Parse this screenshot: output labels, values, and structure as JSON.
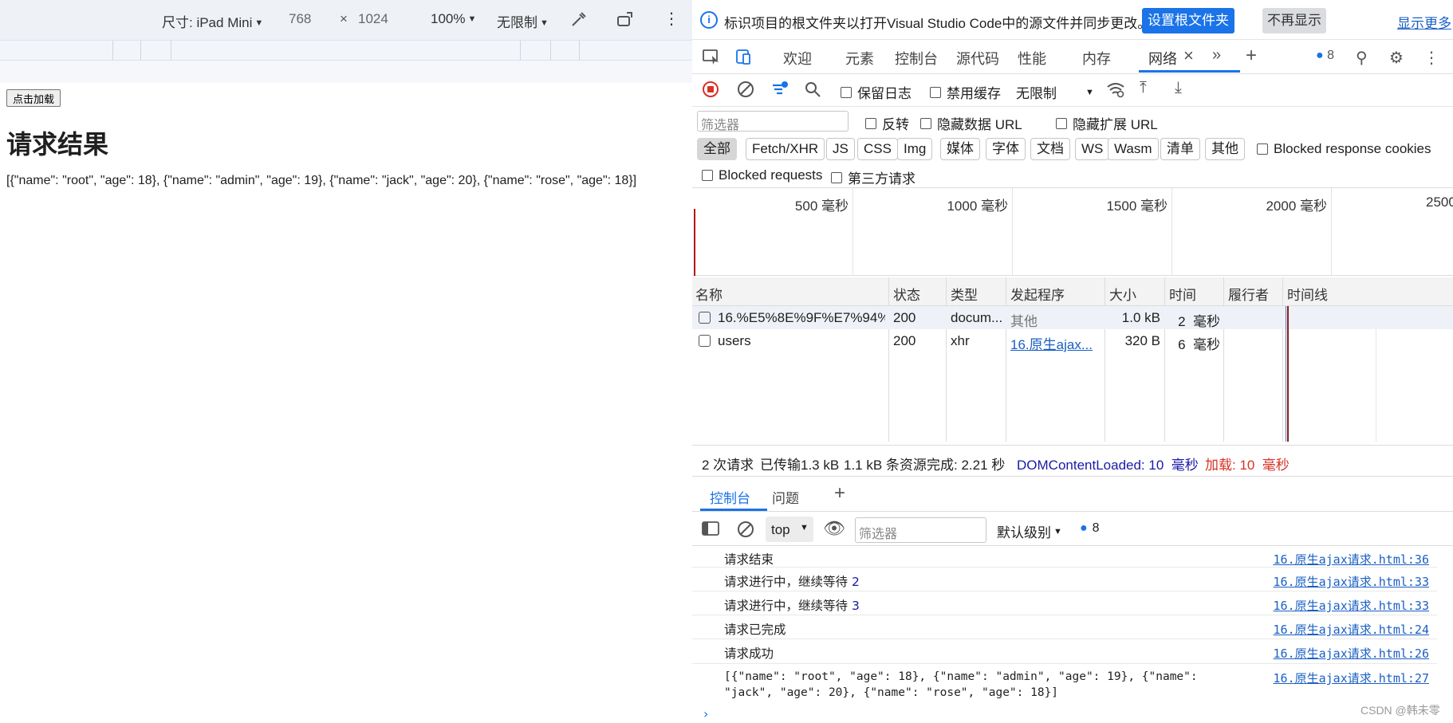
{
  "device_toolbar": {
    "dimensions_label": "尺寸: iPad Mini",
    "width": "768",
    "times": "×",
    "height": "1024",
    "zoom": "100%",
    "throttle": "无限制"
  },
  "page": {
    "button_label": "点击加载",
    "heading": "请求结果",
    "result": "[{\"name\": \"root\", \"age\": 18}, {\"name\": \"admin\", \"age\": 19}, {\"name\": \"jack\", \"age\": 20}, {\"name\": \"rose\", \"age\": 18}]"
  },
  "infobar": {
    "icon": "i",
    "message": "标识项目的根文件夹以打开Visual Studio Code中的源文件并同步更改。",
    "set_root_label": "设置根文件夹",
    "dont_show_label": "不再显示",
    "show_more_label": "显示更多"
  },
  "tabs": {
    "welcome": "欢迎",
    "elements": "元素",
    "console": "控制台",
    "sources": "源代码",
    "performance": "性能",
    "memory": "内存",
    "network": "网络",
    "issues_count": "8"
  },
  "network_toolbar": {
    "preserve_log": "保留日志",
    "disable_cache": "禁用缓存",
    "throttle": "无限制"
  },
  "filters": {
    "placeholder": "筛选器",
    "invert": "反转",
    "hide_data_urls": "隐藏数据 URL",
    "hide_ext_urls": "隐藏扩展 URL",
    "types": [
      "全部",
      "Fetch/XHR",
      "JS",
      "CSS",
      "Img",
      "媒体",
      "字体",
      "文档",
      "WS",
      "Wasm",
      "清单",
      "其他"
    ],
    "blocked_cookies": "Blocked response cookies",
    "blocked_requests": "Blocked requests",
    "third_party": "第三方请求"
  },
  "overview": {
    "labels": [
      "500  毫秒",
      "1000  毫秒",
      "1500  毫秒",
      "2000  毫秒",
      "2500"
    ]
  },
  "table": {
    "headers": {
      "name": "名称",
      "status": "状态",
      "type": "类型",
      "initiator": "发起程序",
      "size": "大小",
      "time": "时间",
      "fulfilled": "履行者",
      "waterfall": "时间线"
    },
    "rows": [
      {
        "name": "16.%E5%8E%9F%E7%94%9...",
        "status": "200",
        "type": "docum...",
        "initiator": "其他",
        "size": "1.0 kB",
        "time": "2  毫秒"
      },
      {
        "name": "users",
        "status": "200",
        "type": "xhr",
        "initiator": "16.原生ajax...",
        "size": "320 B",
        "time": "6  毫秒"
      }
    ]
  },
  "summary": {
    "requests": "2 次请求",
    "transferred": "已传输1.3 kB",
    "resources": "1.1 kB 条资源",
    "finish": "完成: 2.21 秒",
    "dcl": "DOMContentLoaded: 10  毫秒",
    "load": "加载: 10  毫秒"
  },
  "drawer": {
    "console_tab": "控制台",
    "issues_tab": "问题"
  },
  "console_toolbar": {
    "context": "top",
    "filter_placeholder": "筛选器",
    "levels": "默认级别",
    "issues_count": "8"
  },
  "console_messages": [
    {
      "text": "请求结束",
      "count": "",
      "source": "16.原生ajax请求.html:36"
    },
    {
      "text": "请求进行中，继续等待 ",
      "count": "2",
      "source": "16.原生ajax请求.html:33"
    },
    {
      "text": "请求进行中，继续等待 ",
      "count": "3",
      "source": "16.原生ajax请求.html:33"
    },
    {
      "text": "请求已完成",
      "count": "",
      "source": "16.原生ajax请求.html:24"
    },
    {
      "text": "请求成功",
      "count": "",
      "source": "16.原生ajax请求.html:26"
    },
    {
      "text": "[{\"name\": \"root\", \"age\": 18}, {\"name\": \"admin\", \"age\": 19}, {\"name\":\n\"jack\", \"age\": 20}, {\"name\": \"rose\", \"age\": 18}]",
      "count": "",
      "source": "16.原生ajax请求.html:27"
    }
  ],
  "watermark": "CSDN @韩未零",
  "colors": {
    "accent": "#1a73e8",
    "error_red": "#d93025",
    "link_blue": "#1a5fc4"
  }
}
